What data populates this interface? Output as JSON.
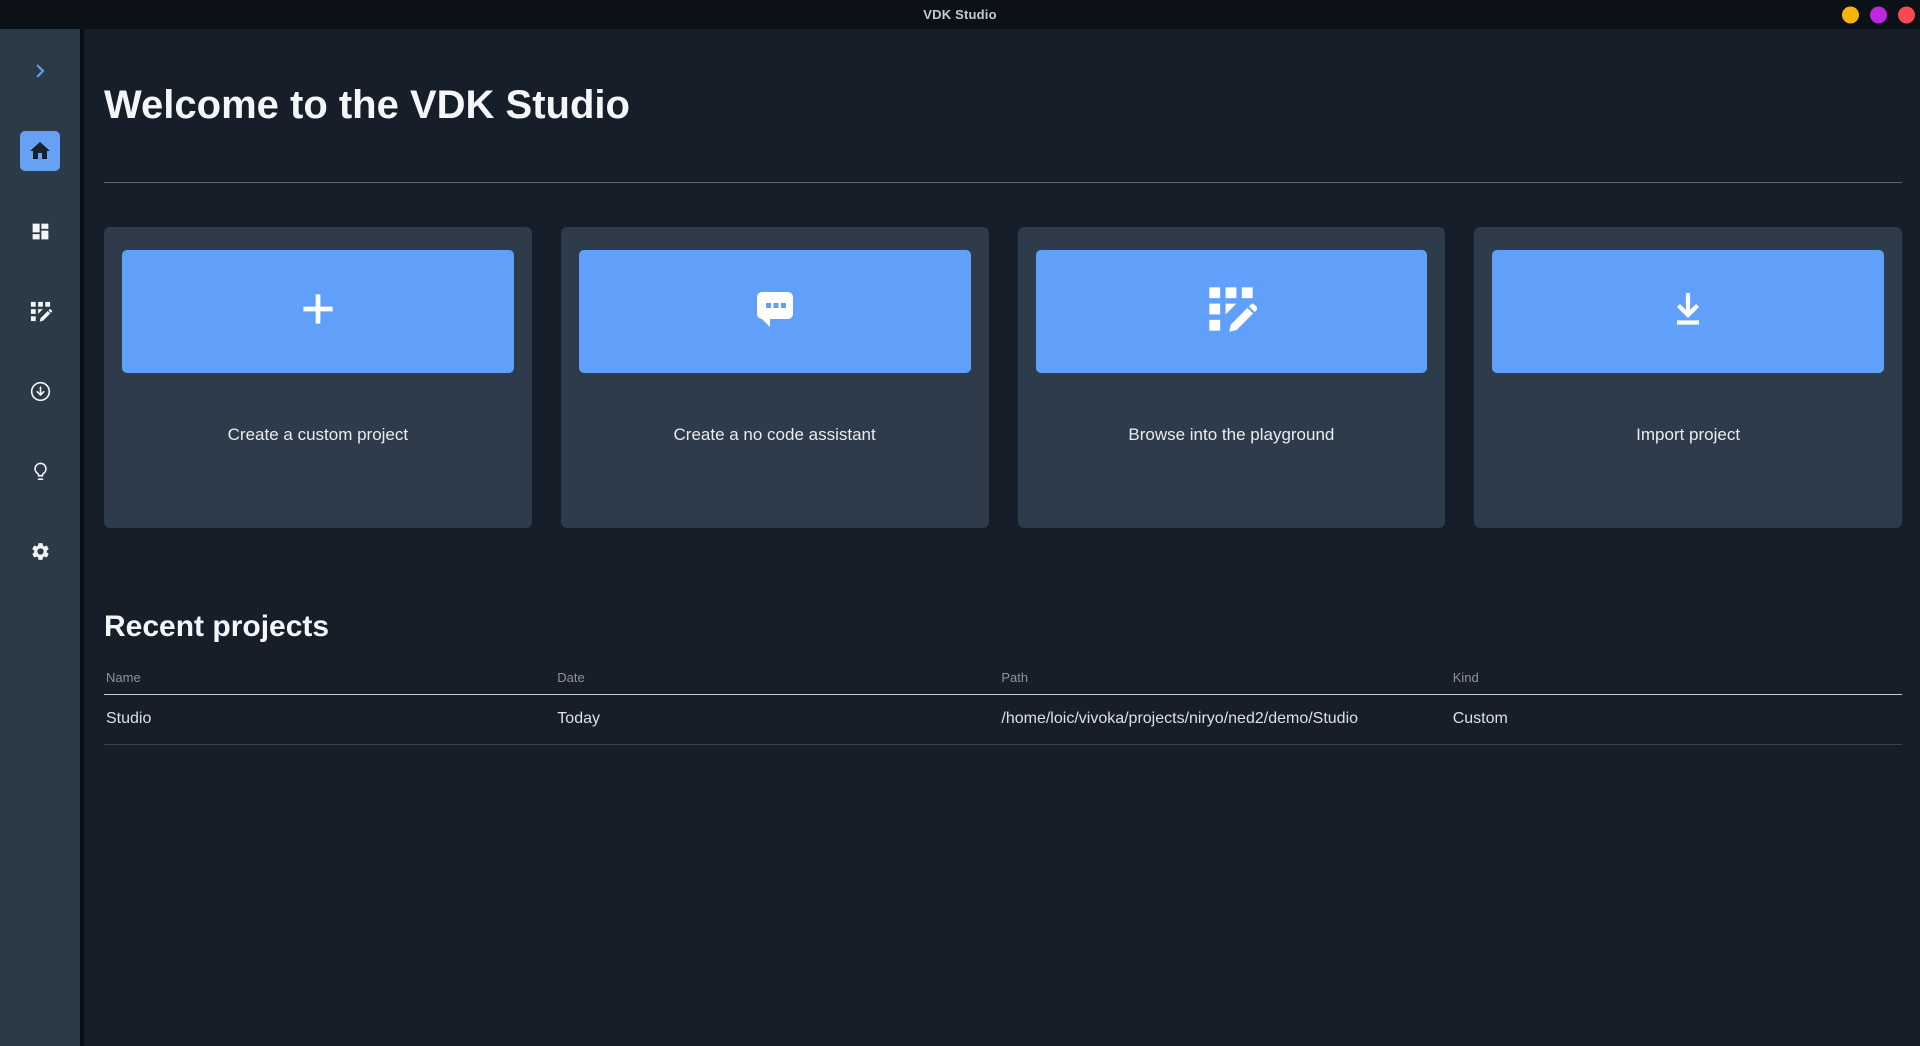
{
  "titlebar": {
    "title": "VDK Studio",
    "window_dots": [
      {
        "name": "window-dot-yellow",
        "color": "#f5b50a"
      },
      {
        "name": "window-dot-purple",
        "color": "#c026e0"
      },
      {
        "name": "window-dot-red",
        "color": "#fb4953"
      }
    ]
  },
  "sidebar": {
    "items": [
      {
        "icon": "chevron-right-icon",
        "active": false
      },
      {
        "icon": "home-icon",
        "active": true
      },
      {
        "icon": "dashboard-icon",
        "active": false
      },
      {
        "icon": "grid-edit-icon",
        "active": false
      },
      {
        "icon": "download-circle-icon",
        "active": false
      },
      {
        "icon": "lightbulb-icon",
        "active": false
      },
      {
        "icon": "gear-icon",
        "active": false
      }
    ]
  },
  "main": {
    "welcome_title": "Welcome to the VDK Studio",
    "cards": [
      {
        "icon": "plus-icon",
        "label": "Create a custom project"
      },
      {
        "icon": "chat-icon",
        "label": "Create a no code assistant"
      },
      {
        "icon": "grid-edit-icon",
        "label": "Browse into the playground"
      },
      {
        "icon": "download-icon",
        "label": "Import project"
      }
    ],
    "recent": {
      "title": "Recent projects",
      "columns": [
        "Name",
        "Date",
        "Path",
        "Kind"
      ],
      "rows": [
        {
          "name": "Studio",
          "date": "Today",
          "path": "/home/loic/vivoka/projects/niryo/ned2/demo/Studio",
          "kind": "Custom"
        }
      ]
    }
  },
  "colors": {
    "titlebar_bg": "#0c1117",
    "main_bg": "#151e29",
    "sidebar_bg": "#2b3a47",
    "card_bg": "#2d3b4a",
    "banner_blue": "#61a0fa",
    "active_item_blue": "#66a1f6",
    "accent_chevron_blue": "#5d9cf8"
  }
}
